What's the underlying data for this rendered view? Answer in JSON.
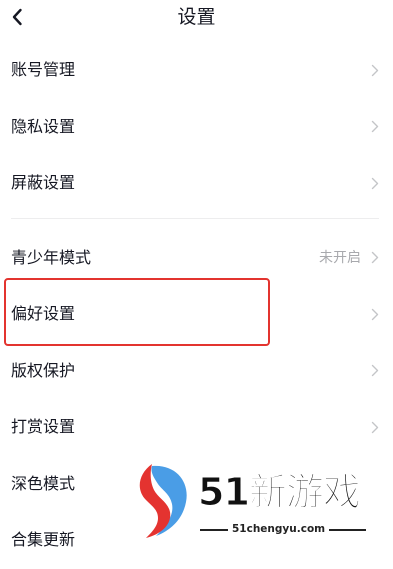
{
  "header": {
    "title": "设置"
  },
  "settings": {
    "items": [
      {
        "label": "账号管理",
        "value": ""
      },
      {
        "label": "隐私设置",
        "value": ""
      },
      {
        "label": "屏蔽设置",
        "value": ""
      },
      {
        "label": "青少年模式",
        "value": "未开启"
      },
      {
        "label": "偏好设置",
        "value": ""
      },
      {
        "label": "版权保护",
        "value": ""
      },
      {
        "label": "打赏设置",
        "value": ""
      },
      {
        "label": "深色模式",
        "value": ""
      },
      {
        "label": "合集更新",
        "value": ""
      }
    ]
  },
  "watermark": {
    "brand": "51新游戏",
    "url": "51chengyu.com"
  },
  "colors": {
    "highlight_border": "#e3342f",
    "secondary_text": "#a8a9ad"
  }
}
